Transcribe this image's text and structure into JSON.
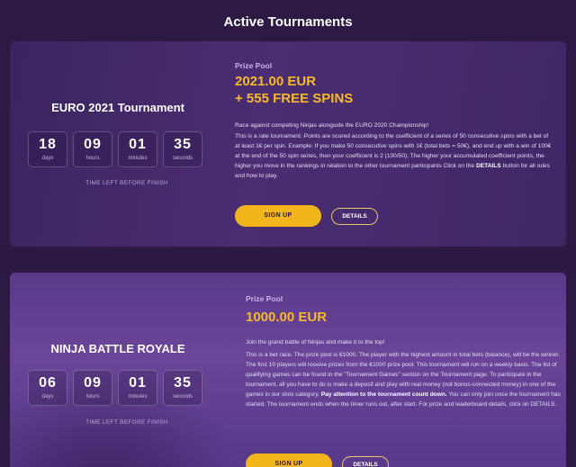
{
  "page": {
    "title": "Active Tournaments"
  },
  "tournaments": [
    {
      "name": "EURO 2021 Tournament",
      "timer": [
        {
          "value": "18",
          "unit": "days"
        },
        {
          "value": "09",
          "unit": "hours"
        },
        {
          "value": "01",
          "unit": "minutes"
        },
        {
          "value": "35",
          "unit": "seconds"
        }
      ],
      "time_left_label": "TIME LEFT BEFORE FINISH",
      "prize_label": "Prize Pool",
      "prize_line1": "2021.00 EUR",
      "prize_line2": "+ 555 FREE SPINS",
      "desc_intro": "Race against competing Ninjas alongside the EURO 2020 Championship!",
      "desc_body": "This is a rate tournament. Points are scored according to the coefficient of a series of 50 consecutive spins with a bet of at least 1€ per spin. Example: If you make 50 consecutive spins with 1€ (total bets = 50€), and end up with a win of 100€ at the end of the 50 spin series, then your coefficient is 2 (100/50). The higher your accumulated coefficient points, the higher you move in the rankings in relation to the other tournament participants Click on the ",
      "desc_bold": "DETAILS",
      "desc_tail": " button for all rules and how to play.",
      "signup_label": "SIGN UP",
      "details_label": "DETAILS"
    },
    {
      "name": "NINJA BATTLE ROYALE",
      "timer": [
        {
          "value": "06",
          "unit": "days"
        },
        {
          "value": "09",
          "unit": "hours"
        },
        {
          "value": "01",
          "unit": "minutes"
        },
        {
          "value": "35",
          "unit": "seconds"
        }
      ],
      "time_left_label": "TIME LEFT BEFORE FINISH",
      "prize_label": "Prize Pool",
      "prize_line1": "1000.00 EUR",
      "desc_intro": "Join the grand battle of Ninjas and make it to the top!",
      "desc_body": "This is a bet race. The prize pool is €1000. The player with the highest amount in total bets (balance), will be the winner. The first 10 players will receive prizes from the €1000 prize pool. This tournament will run on a weekly basis. The list of qualifying games can be found in the \"Tournament Games\" section on the Tournament page. To participate in the tournament, all you have to do is make a deposit and play with real money (not bonus-connected money) in one of the games in our slots category. ",
      "desc_bold": "Pay attention to the tournament count down.",
      "desc_tail": " You can only join once the tournament has started. The tournament ends when the timer runs out, after start. For prize and leaderboard details, click on DETAILS.",
      "signup_label": "SIGN UP",
      "details_label": "DETAILS"
    }
  ]
}
